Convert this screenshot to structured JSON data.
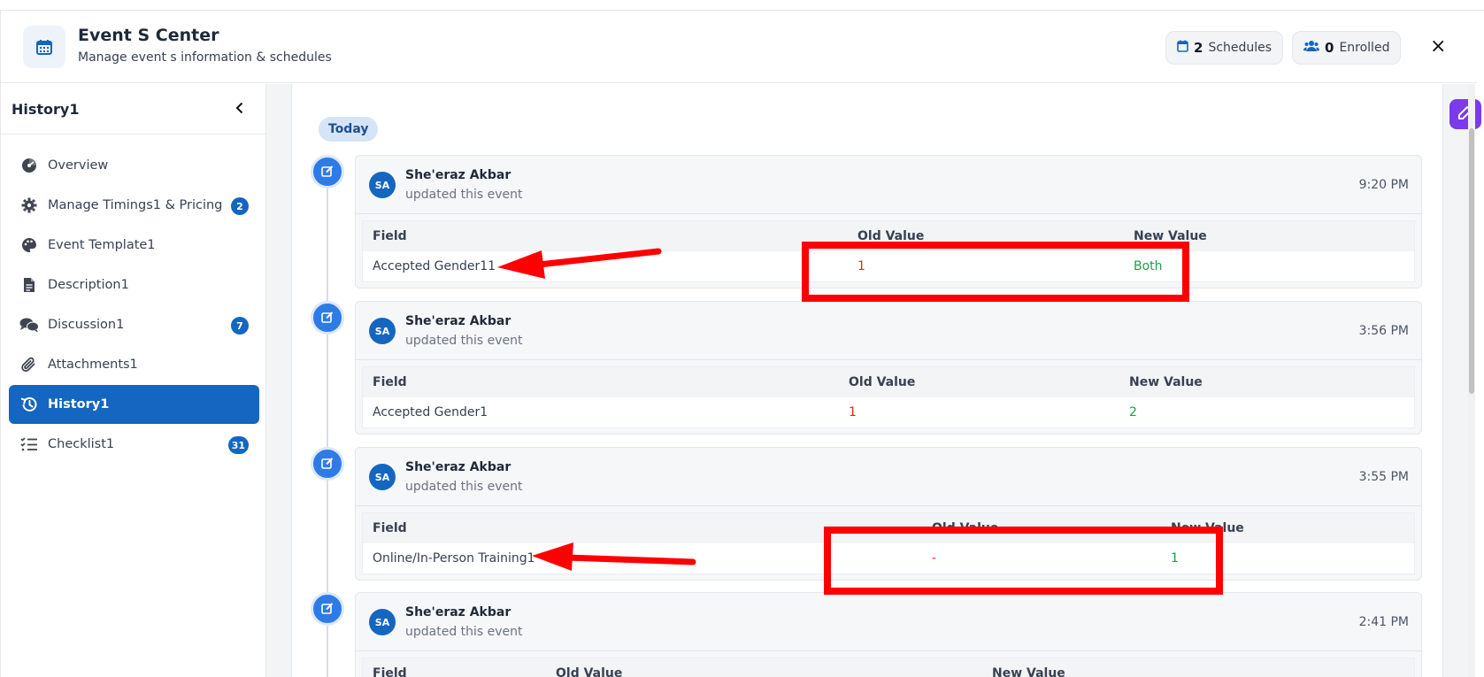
{
  "header": {
    "title": "Event S Center",
    "subtitle": "Manage event s information & schedules",
    "schedules_count": "2",
    "schedules_label": "Schedules",
    "enrolled_count": "0",
    "enrolled_label": "Enrolled",
    "close_label": "×"
  },
  "sidebar": {
    "title": "History1",
    "items": [
      {
        "label": "Overview",
        "icon": "pie-chart-icon"
      },
      {
        "label": "Manage Timings1 & Pricing",
        "icon": "gear-icon",
        "badge": "2"
      },
      {
        "label": "Event Template1",
        "icon": "palette-icon"
      },
      {
        "label": "Description1",
        "icon": "document-icon"
      },
      {
        "label": "Discussion1",
        "icon": "comments-icon",
        "badge": "7"
      },
      {
        "label": "Attachments1",
        "icon": "paperclip-icon"
      },
      {
        "label": "History1",
        "icon": "history-icon",
        "active": true
      },
      {
        "label": "Checklist1",
        "icon": "checklist-icon",
        "badge": "31"
      }
    ]
  },
  "timeline": {
    "group_label": "Today",
    "entries": [
      {
        "initials": "SA",
        "user": "She'eraz Akbar",
        "action": "updated this event",
        "time": "9:20 PM",
        "headers": {
          "field": "Field",
          "old": "Old Value",
          "new": "New Value"
        },
        "row": {
          "field": "Accepted Gender11",
          "old": "1",
          "new": "Both"
        }
      },
      {
        "initials": "SA",
        "user": "She'eraz Akbar",
        "action": "updated this event",
        "time": "3:56 PM",
        "headers": {
          "field": "Field",
          "old": "Old Value",
          "new": "New Value"
        },
        "row": {
          "field": "Accepted Gender1",
          "old": "1",
          "new": "2"
        }
      },
      {
        "initials": "SA",
        "user": "She'eraz Akbar",
        "action": "updated this event",
        "time": "3:55 PM",
        "headers": {
          "field": "Field",
          "old": "Old Value",
          "new": "New Value"
        },
        "row": {
          "field": "Online/In-Person Training1",
          "old": "-",
          "new": "1"
        }
      },
      {
        "initials": "SA",
        "user": "She'eraz Akbar",
        "action": "updated this event",
        "time": "2:41 PM",
        "headers": {
          "field": "Field",
          "old": "Old Value",
          "new": "New Value"
        }
      }
    ]
  },
  "colors": {
    "primary": "#1466c0",
    "timeline_dot": "#2f7be6",
    "old_value": "#dc2626",
    "new_value": "#16a34a",
    "annotation": "#ff0000",
    "float_button": "#7c3aed"
  }
}
